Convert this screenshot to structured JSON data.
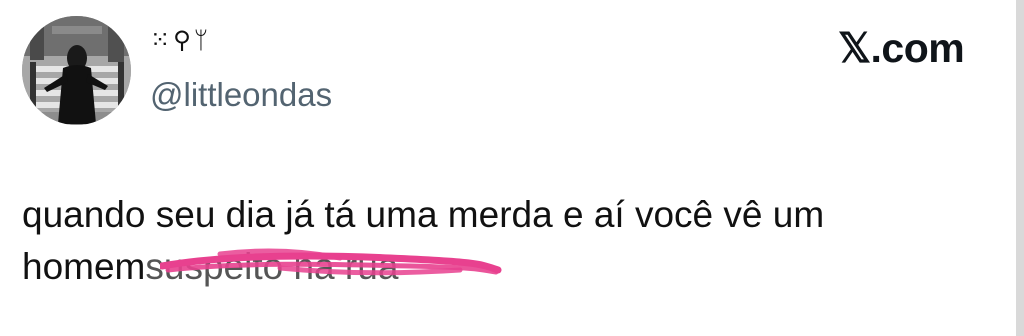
{
  "post": {
    "display_name": "⁙⚲ᛘ",
    "handle": "@littleondas",
    "brand": "𝕏.com",
    "text_line_1": "quando seu dia já tá uma merda e aí você vê um",
    "text_line_2": "homem",
    "text_struck": "suspeito na rua"
  },
  "colors": {
    "handle": "#536471",
    "scribble": "#e8418f"
  }
}
